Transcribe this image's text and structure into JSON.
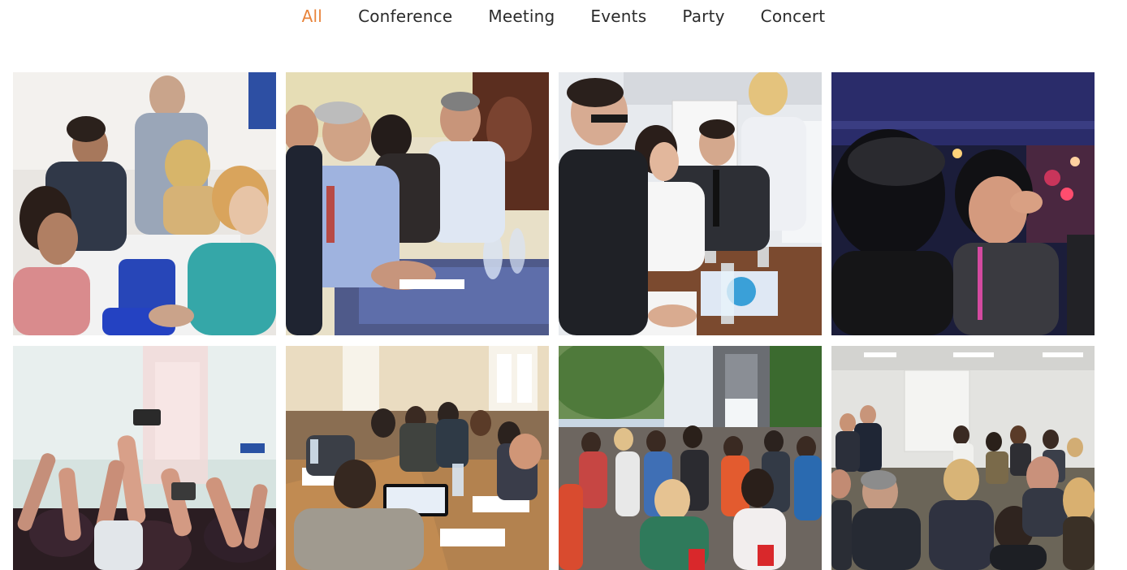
{
  "filters": {
    "active_color": "#e8833a",
    "items": [
      {
        "label": "All",
        "active": true
      },
      {
        "label": "Conference",
        "active": false
      },
      {
        "label": "Meeting",
        "active": false
      },
      {
        "label": "Events",
        "active": false
      },
      {
        "label": "Party",
        "active": false
      },
      {
        "label": "Concert",
        "active": false
      }
    ]
  },
  "gallery": {
    "items": [
      {
        "name": "photo-conference-table-discussion"
      },
      {
        "name": "photo-business-roundtable"
      },
      {
        "name": "photo-office-meeting-documents"
      },
      {
        "name": "photo-face-painting-party"
      },
      {
        "name": "photo-concert-crowd"
      },
      {
        "name": "photo-conference-room-tables"
      },
      {
        "name": "photo-outdoor-event-crowd"
      },
      {
        "name": "photo-seminar-audience"
      }
    ]
  }
}
